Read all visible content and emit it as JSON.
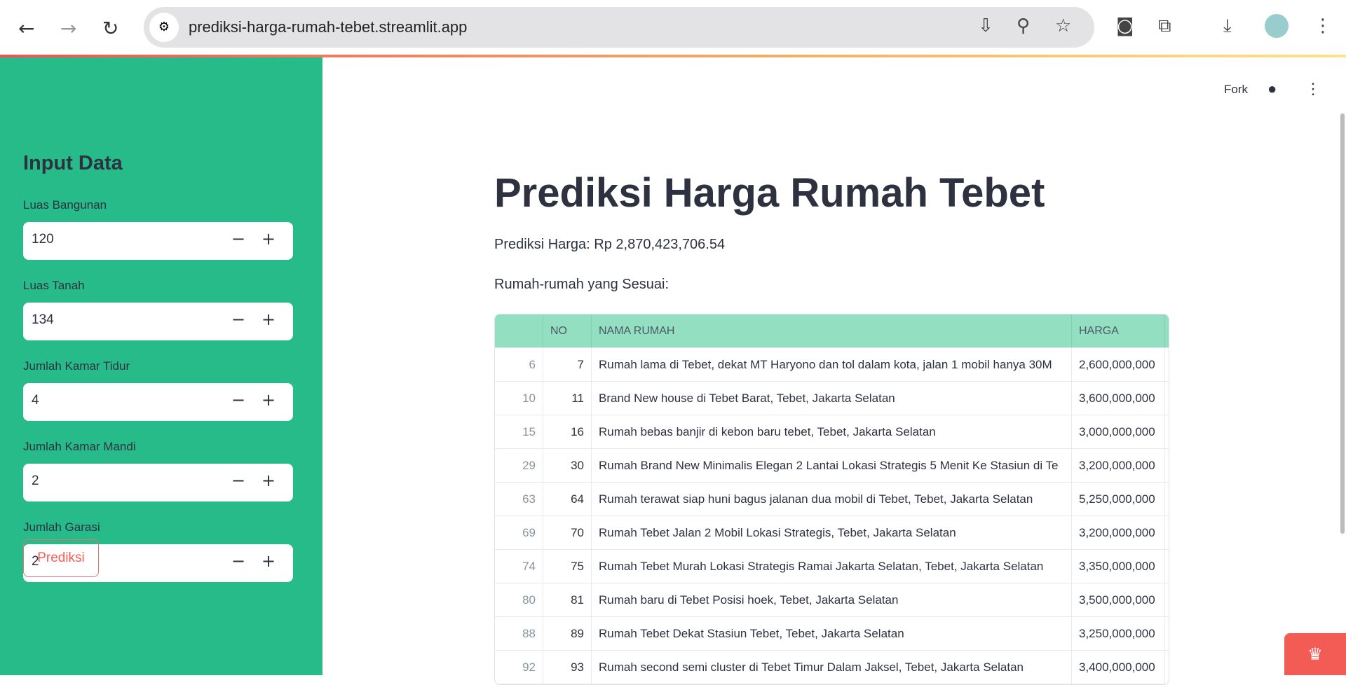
{
  "browser": {
    "url": "prediksi-harga-rumah-tebet.streamlit.app"
  },
  "sidebar": {
    "title": "Input Data",
    "fields": [
      {
        "label": "Luas Bangunan",
        "value": "120"
      },
      {
        "label": "Luas Tanah",
        "value": "134"
      },
      {
        "label": "Jumlah Kamar Tidur",
        "value": "4"
      },
      {
        "label": "Jumlah Kamar Mandi",
        "value": "2"
      },
      {
        "label": "Jumlah Garasi",
        "value": "2"
      }
    ],
    "button": "Prediksi"
  },
  "header": {
    "fork": "Fork"
  },
  "main": {
    "title": "Prediksi Harga Rumah Tebet",
    "prediction": "Prediksi Harga: Rp 2,870,423,706.54",
    "subtitle": "Rumah-rumah yang Sesuai:",
    "columns": [
      "",
      "NO",
      "NAMA RUMAH",
      "HARGA"
    ],
    "rows": [
      [
        "6",
        "7",
        "Rumah lama di Tebet, dekat MT Haryono dan tol dalam kota, jalan 1 mobil hanya 30M",
        "2,600,000,000"
      ],
      [
        "10",
        "11",
        "Brand New house di Tebet Barat, Tebet, Jakarta Selatan",
        "3,600,000,000"
      ],
      [
        "15",
        "16",
        "Rumah bebas banjir di kebon baru tebet, Tebet, Jakarta Selatan",
        "3,000,000,000"
      ],
      [
        "29",
        "30",
        "Rumah Brand New Minimalis Elegan 2 Lantai Lokasi Strategis 5 Menit Ke Stasiun di Te",
        "3,200,000,000"
      ],
      [
        "63",
        "64",
        "Rumah terawat siap huni bagus jalanan dua mobil di Tebet, Tebet, Jakarta Selatan",
        "5,250,000,000"
      ],
      [
        "69",
        "70",
        "Rumah Tebet Jalan 2 Mobil Lokasi Strategis, Tebet, Jakarta Selatan",
        "3,200,000,000"
      ],
      [
        "74",
        "75",
        "Rumah Tebet Murah Lokasi Strategis Ramai Jakarta Selatan, Tebet, Jakarta Selatan",
        "3,350,000,000"
      ],
      [
        "80",
        "81",
        "Rumah baru di Tebet Posisi hoek, Tebet, Jakarta Selatan",
        "3,500,000,000"
      ],
      [
        "88",
        "89",
        "Rumah Tebet Dekat Stasiun Tebet, Tebet, Jakarta Selatan",
        "3,250,000,000"
      ],
      [
        "92",
        "93",
        "Rumah second semi cluster di Tebet Timur Dalam Jaksel, Tebet, Jakarta Selatan",
        "3,400,000,000"
      ]
    ]
  },
  "colors": {
    "sidebar": "#27bb8a",
    "table_header": "#93dfc1",
    "accent": "#f25c54"
  }
}
